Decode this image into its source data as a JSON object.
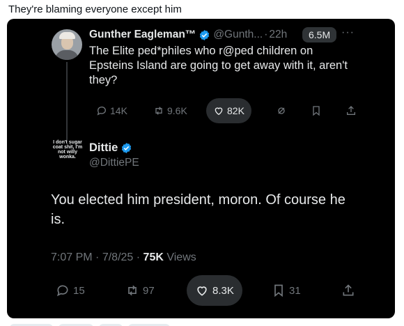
{
  "caption": "They're blaming everyone except him",
  "colors": {
    "background": "#000000",
    "text": "#e7e9ea",
    "muted": "#71767b",
    "verified": "#1d9bf0",
    "pill": "#2f3336"
  },
  "parent_tweet": {
    "author_name": "Gunther Eagleman™",
    "handle": "@Gunth...",
    "separator": "·",
    "time": "22h",
    "views": "6.5M",
    "more": "···",
    "text": "The Elite ped*philes who r@ped children on Epsteins Island are going to get away with it, aren't they?",
    "replies": "14K",
    "reposts": "9.6K",
    "likes": "82K",
    "icons": [
      "reply-icon",
      "repost-icon",
      "like-icon",
      "grok-icon",
      "bookmark-icon",
      "share-icon"
    ]
  },
  "main_tweet": {
    "author_name": "Dittie",
    "handle": "@DittiePE",
    "avatar_text": "I don't sugar coat shit, I'm not willy wonka.",
    "text": "You elected him president, moron. Of course he is.",
    "time": "7:07 PM",
    "date": "7/8/25",
    "sep": "·",
    "views_count": "75K",
    "views_label": "Views",
    "replies": "15",
    "reposts": "97",
    "likes": "8.3K",
    "bookmarks": "31",
    "icons": [
      "reply-icon",
      "repost-icon",
      "like-icon",
      "bookmark-icon",
      "share-icon"
    ]
  }
}
